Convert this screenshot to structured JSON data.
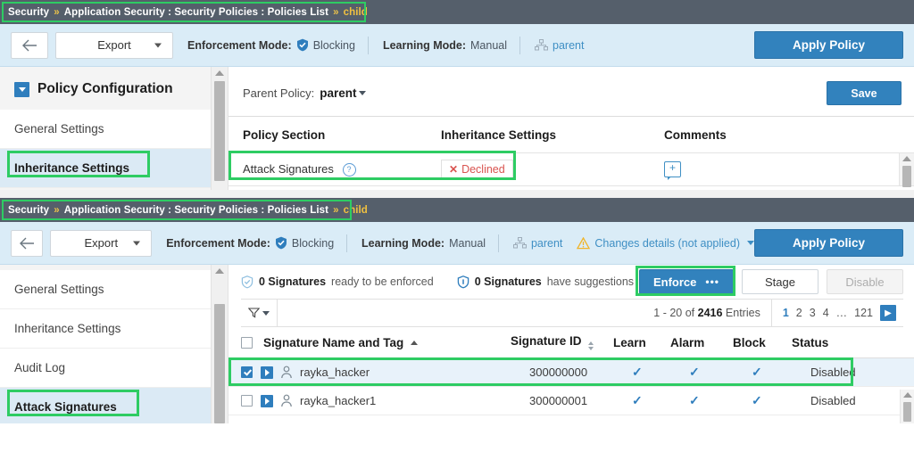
{
  "panel1": {
    "breadcrumb": {
      "root": "Security",
      "separator": "»",
      "path": "Application Security : Security Policies : Policies List",
      "leaf": "child",
      "highlighted": true,
      "highlight_color": "#2ecc63"
    },
    "toolbar": {
      "back_icon": "arrow-left-icon",
      "export_label": "Export",
      "enforcement_label": "Enforcement Mode:",
      "enforcement_value": "Blocking",
      "learning_label": "Learning Mode:",
      "learning_value": "Manual",
      "parent_link": "parent",
      "apply_label": "Apply Policy",
      "apply_color": "#3282bd"
    },
    "sidebar": {
      "title": "Policy Configuration",
      "items": [
        {
          "label": "General Settings",
          "active": false,
          "highlighted": false
        },
        {
          "label": "Inheritance Settings",
          "active": true,
          "highlighted": true
        }
      ]
    },
    "content": {
      "parent_policy_label": "Parent Policy:",
      "parent_policy_value": "parent",
      "save_label": "Save",
      "columns": [
        "Policy Section",
        "Inheritance Settings",
        "Comments"
      ],
      "rows": [
        {
          "section": "Attack Signatures",
          "help_icon": "question-mark-icon",
          "inheritance": "Declined",
          "inheritance_state": "declined",
          "inheritance_color": "#d9534f",
          "comment_icon": "add-comment-icon",
          "highlighted": true
        }
      ]
    }
  },
  "panel2": {
    "breadcrumb": {
      "root": "Security",
      "separator": "»",
      "path": "Application Security : Security Policies : Policies List",
      "leaf": "child",
      "highlighted": true
    },
    "toolbar": {
      "back_icon": "arrow-left-icon",
      "export_label": "Export",
      "enforcement_label": "Enforcement Mode:",
      "enforcement_value": "Blocking",
      "learning_label": "Learning Mode:",
      "learning_value": "Manual",
      "parent_link": "parent",
      "changes_link": "Changes details (not applied)",
      "apply_label": "Apply Policy"
    },
    "sidebar": {
      "items": [
        {
          "label": "General Settings",
          "active": false,
          "highlighted": false
        },
        {
          "label": "Inheritance Settings",
          "active": false,
          "highlighted": false
        },
        {
          "label": "Audit Log",
          "active": false,
          "highlighted": false
        },
        {
          "label": "Attack Signatures",
          "active": true,
          "highlighted": true
        }
      ]
    },
    "signatures": {
      "stat1_count": "0 Signatures",
      "stat1_text": "ready to be enforced",
      "stat1_icon": "shield-check-icon",
      "stat2_count": "0 Signatures",
      "stat2_text": "have suggestions",
      "stat2_icon": "shield-info-icon",
      "enforce_label": "Enforce",
      "enforce_more": "•••",
      "enforce_highlighted": true,
      "stage_label": "Stage",
      "disable_label": "Disable",
      "disable_enabled": false,
      "filter_icon": "filter-icon",
      "entries_prefix": "1 - 20 of",
      "entries_total": "2416",
      "entries_suffix": "Entries",
      "pages": [
        "1",
        "2",
        "3",
        "4",
        "…",
        "121"
      ],
      "current_page": "1",
      "next_icon": "chevron-right-icon",
      "columns": {
        "name": "Signature Name and Tag",
        "id": "Signature ID",
        "learn": "Learn",
        "alarm": "Alarm",
        "block": "Block",
        "status": "Status"
      },
      "rows": [
        {
          "checked": true,
          "expand_icon": "expand-arrow-icon",
          "type_icon": "user-signature-icon",
          "name": "rayka_hacker",
          "id": "300000000",
          "learn": "✓",
          "alarm": "✓",
          "block": "✓",
          "status": "Disabled",
          "highlighted": true
        },
        {
          "checked": false,
          "expand_icon": "expand-arrow-icon",
          "type_icon": "user-signature-icon",
          "name": "rayka_hacker1",
          "id": "300000001",
          "learn": "✓",
          "alarm": "✓",
          "block": "✓",
          "status": "Disabled",
          "highlighted": false
        }
      ]
    }
  }
}
